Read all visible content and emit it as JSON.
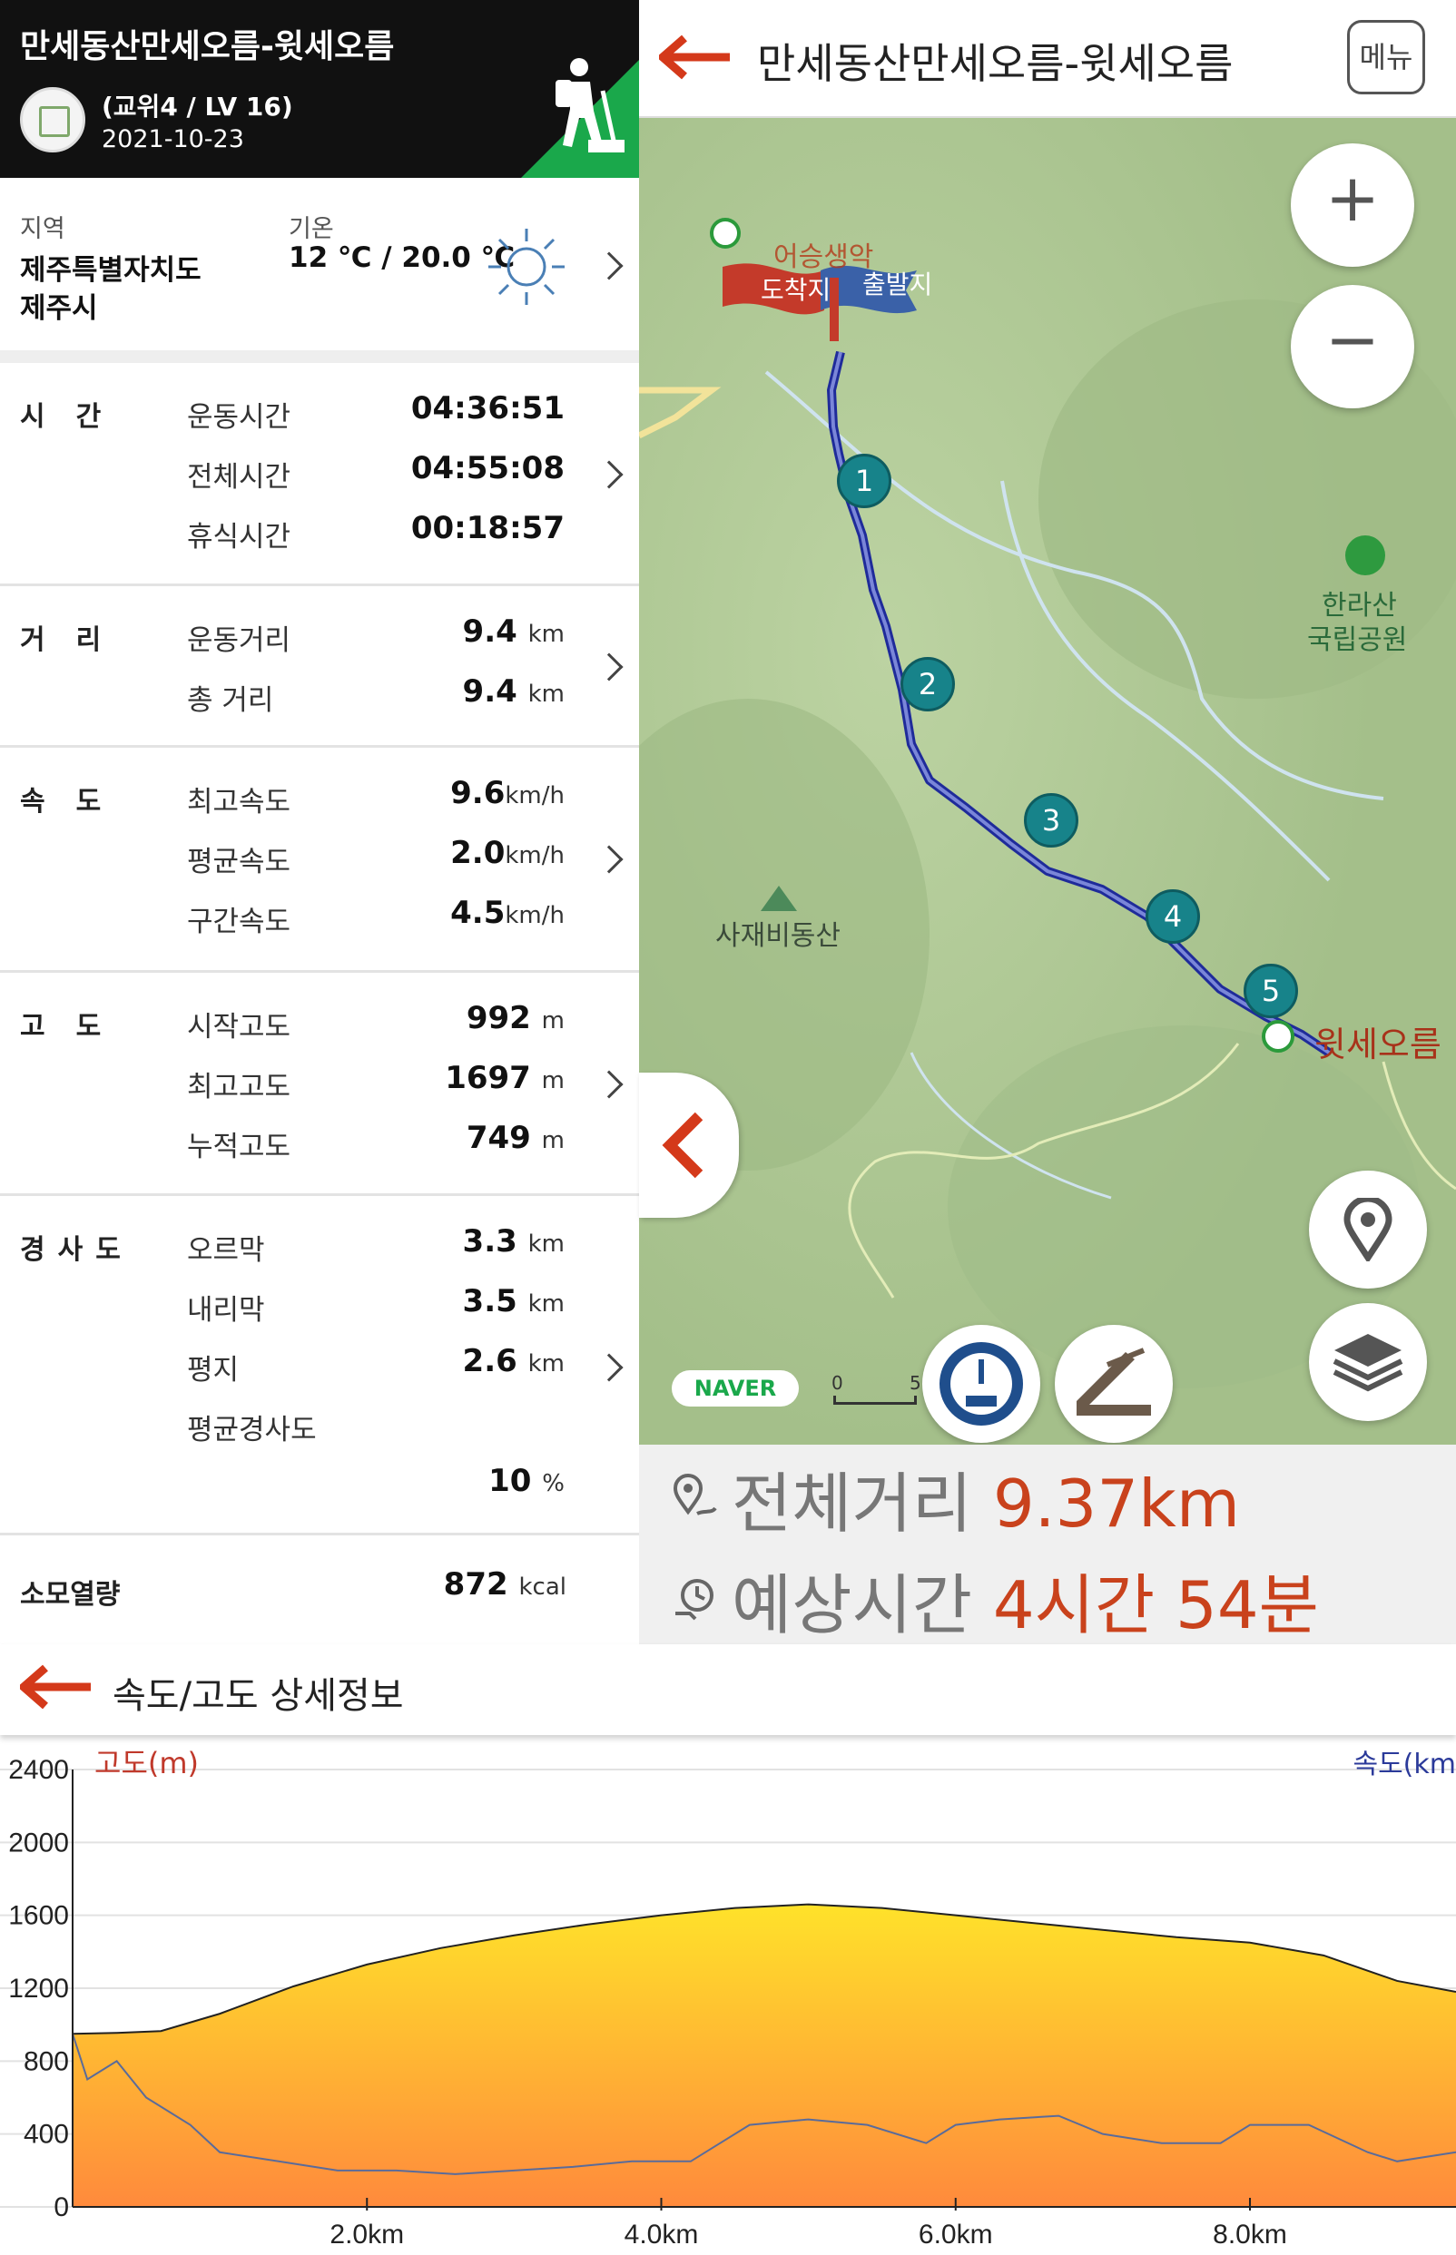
{
  "header": {
    "title": "만세동산만세오름-윗세오름",
    "level": "(교위4 / LV 16)",
    "date": "2021-10-23"
  },
  "region": {
    "label": "지역",
    "value_line1": "제주특별자치도",
    "value_line2": "제주시",
    "temp_label": "기온",
    "temp_value": "12 ℃ / 20.0 ℃",
    "weather_icon": "sun-icon"
  },
  "time": {
    "category": "시간",
    "rows": [
      {
        "label": "운동시간",
        "value": "04:36:51"
      },
      {
        "label": "전체시간",
        "value": "04:55:08"
      },
      {
        "label": "휴식시간",
        "value": "00:18:57"
      }
    ]
  },
  "distance": {
    "category": "거리",
    "rows": [
      {
        "label": "운동거리",
        "value": "9.4",
        "unit": "km"
      },
      {
        "label": "총 거리",
        "value": "9.4",
        "unit": "km"
      }
    ]
  },
  "speed": {
    "category": "속도",
    "rows": [
      {
        "label": "최고속도",
        "value": "9.6",
        "unit": "km/h"
      },
      {
        "label": "평균속도",
        "value": "2.0",
        "unit": "km/h"
      },
      {
        "label": "구간속도",
        "value": "4.5",
        "unit": "km/h"
      }
    ]
  },
  "altitude": {
    "category": "고도",
    "rows": [
      {
        "label": "시작고도",
        "value": "992",
        "unit": "m"
      },
      {
        "label": "최고고도",
        "value": "1697",
        "unit": "m"
      },
      {
        "label": "누적고도",
        "value": "749",
        "unit": "m"
      }
    ]
  },
  "slope": {
    "category": "경사도",
    "rows": [
      {
        "label": "오르막",
        "value": "3.3",
        "unit": "km"
      },
      {
        "label": "내리막",
        "value": "3.5",
        "unit": "km"
      },
      {
        "label": "평지",
        "value": "2.6",
        "unit": "km"
      }
    ],
    "avg_label": "평균경사도",
    "avg_value": "10",
    "avg_unit": "%"
  },
  "calories": {
    "label": "소모열량",
    "value": "872",
    "unit": "kcal"
  },
  "map": {
    "title": "만세동산만세오름-윗세오름",
    "menu_label": "메뉴",
    "flag_arrive": "도착지",
    "flag_depart": "출발지",
    "poi_top": "어승생악",
    "poi_park_line1": "한라산",
    "poi_park_line2": "국립공원",
    "poi_mountain": "사재비동산",
    "poi_end": "윗세오름",
    "waypoints": [
      "1",
      "2",
      "3",
      "4",
      "5"
    ],
    "naver": "NAVER",
    "scale_0": "0",
    "scale_5": "5",
    "zoom_in": "+",
    "zoom_out": "−"
  },
  "summary": {
    "dist_label": "전체거리",
    "dist_value": "9.37km",
    "time_label": "예상시간",
    "time_value": "4시간 54분"
  },
  "chart_section": {
    "title": "속도/고도 상세정보"
  },
  "chart_data": {
    "type": "area",
    "ylabel": "고도(m)",
    "y2label": "속도(km",
    "ylim": [
      0,
      2400
    ],
    "yticks": [
      "2400",
      "2000",
      "1600",
      "1200",
      "800",
      "400",
      "0"
    ],
    "xticks": [
      "2.0km",
      "4.0km",
      "6.0km",
      "8.0km"
    ],
    "xlim": [
      0,
      9.4
    ],
    "elevation": {
      "x": [
        0,
        0.3,
        0.6,
        1.0,
        1.5,
        2.0,
        2.5,
        3.0,
        3.5,
        4.0,
        4.5,
        5.0,
        5.5,
        6.0,
        6.5,
        7.0,
        7.5,
        8.0,
        8.5,
        9.0,
        9.4
      ],
      "y": [
        950,
        955,
        965,
        1060,
        1210,
        1330,
        1420,
        1490,
        1550,
        1600,
        1640,
        1660,
        1640,
        1600,
        1560,
        1520,
        1480,
        1450,
        1380,
        1240,
        1180
      ]
    },
    "speed": {
      "x": [
        0,
        0.1,
        0.3,
        0.5,
        0.8,
        1.0,
        1.4,
        1.8,
        2.2,
        2.6,
        3.0,
        3.4,
        3.8,
        4.2,
        4.4,
        4.6,
        5.0,
        5.4,
        5.8,
        6.0,
        6.3,
        6.7,
        7.0,
        7.4,
        7.8,
        8.0,
        8.4,
        8.8,
        9.0,
        9.4
      ],
      "y": [
        950,
        700,
        800,
        600,
        450,
        300,
        250,
        200,
        200,
        180,
        200,
        220,
        250,
        250,
        350,
        450,
        480,
        450,
        350,
        450,
        480,
        500,
        400,
        350,
        350,
        450,
        450,
        300,
        250,
        300
      ]
    },
    "colors": {
      "elev_top": "#ffe22a",
      "elev_bottom": "#ff8a3c",
      "speed_line": "#5a6b9a",
      "ylabel_color": "#c0392b",
      "y2label_color": "#2b3a9a"
    }
  }
}
